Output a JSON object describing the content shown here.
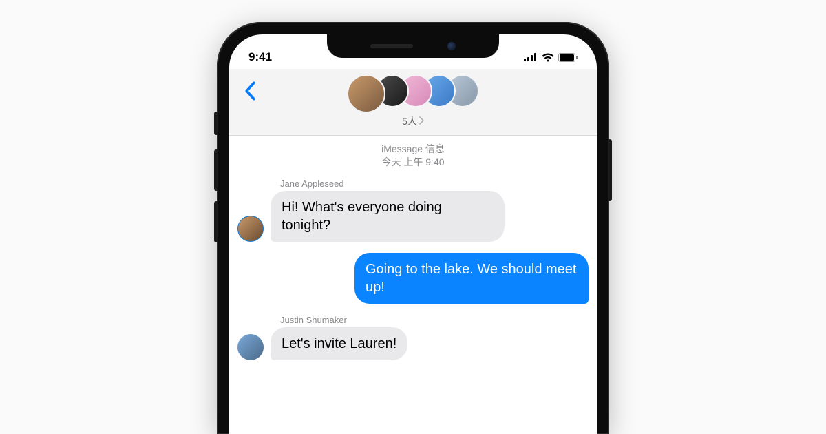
{
  "status": {
    "time": "9:41"
  },
  "header": {
    "group_label": "5人",
    "participant_count": 5
  },
  "meta": {
    "service_label": "iMessage 信息",
    "timestamp": "今天 上午 9:40"
  },
  "messages": [
    {
      "sender": "Jane Appleseed",
      "direction": "in",
      "text": "Hi! What's everyone doing tonight?"
    },
    {
      "sender": "",
      "direction": "out",
      "text": "Going to the lake. We should meet up!"
    },
    {
      "sender": "Justin Shumaker",
      "direction": "in",
      "text": "Let's invite Lauren!"
    }
  ]
}
